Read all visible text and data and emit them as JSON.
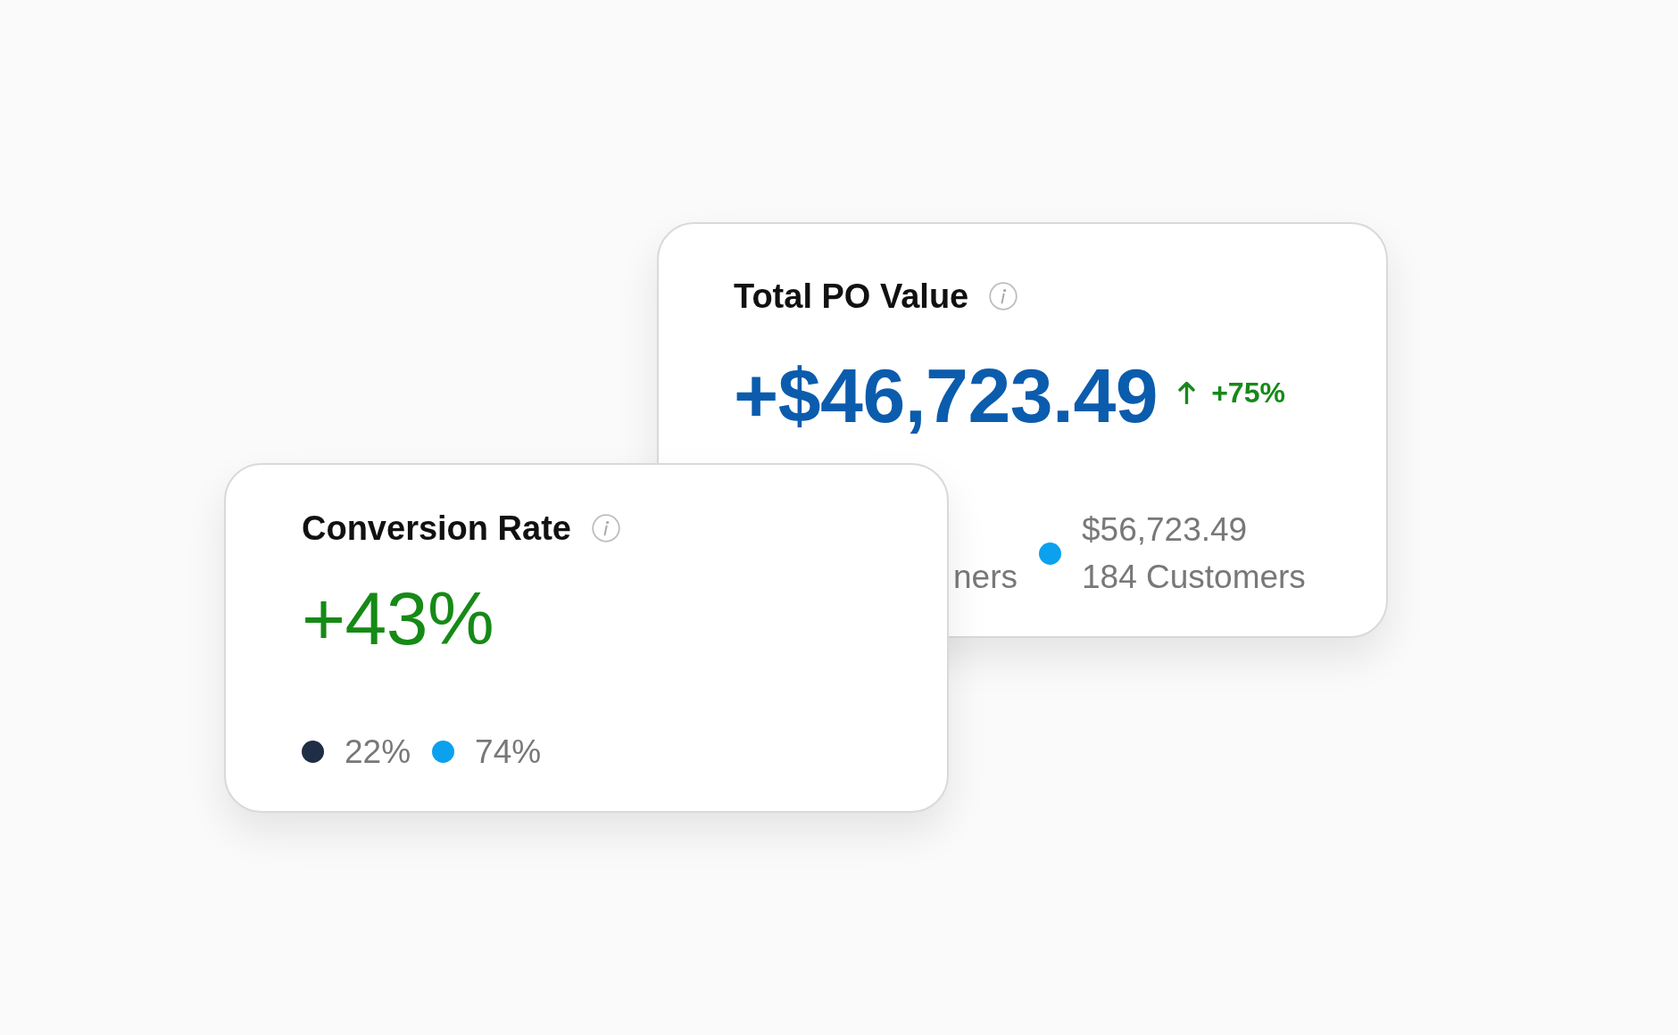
{
  "cards": [
    {
      "kind": "amount",
      "title": "Total PO Value",
      "value": "+$46,723.49",
      "change": {
        "kind": "up",
        "text": "+75%"
      },
      "legend": [
        {
          "caption": "ners"
        },
        {
          "color": "#0ba1ee",
          "value": "$56,723.49",
          "caption": "184 Customers"
        }
      ]
    },
    {
      "kind": "rate",
      "title": "Conversion Rate",
      "value": "+43%",
      "legend": [
        {
          "color": "#1f2e44",
          "value": "22%"
        },
        {
          "color": "#0ba1ee",
          "value": "74%"
        }
      ]
    }
  ]
}
